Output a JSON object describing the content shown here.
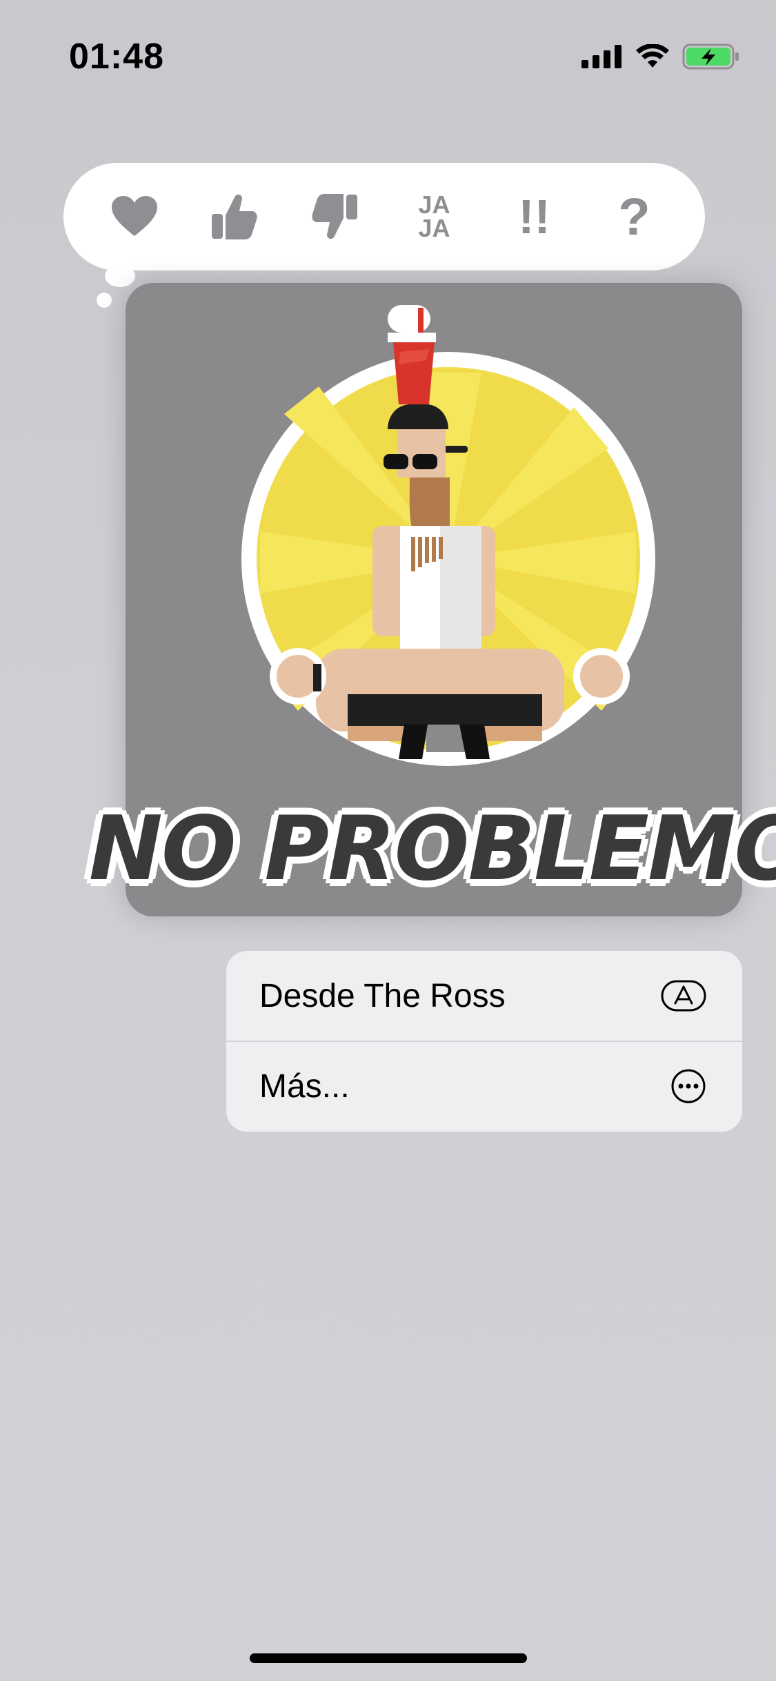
{
  "status_bar": {
    "time": "01:48",
    "icons": [
      "cellular-signal-icon",
      "wifi-icon",
      "battery-charging-icon"
    ]
  },
  "tapback": {
    "items": [
      {
        "name": "heart",
        "label": ""
      },
      {
        "name": "thumbs-up",
        "label": ""
      },
      {
        "name": "thumbs-down",
        "label": ""
      },
      {
        "name": "haha",
        "label_line1": "JA",
        "label_line2": "JA"
      },
      {
        "name": "exclamation",
        "label": "!!"
      },
      {
        "name": "question",
        "label": "?"
      }
    ],
    "icon_color": "#8e8e93"
  },
  "sticker": {
    "caption": "NO PROBLEMO"
  },
  "menu": {
    "items": [
      {
        "label": "Desde The Ross",
        "icon": "app-store-icon"
      },
      {
        "label": "Más...",
        "icon": "more-ellipsis-icon"
      }
    ]
  }
}
